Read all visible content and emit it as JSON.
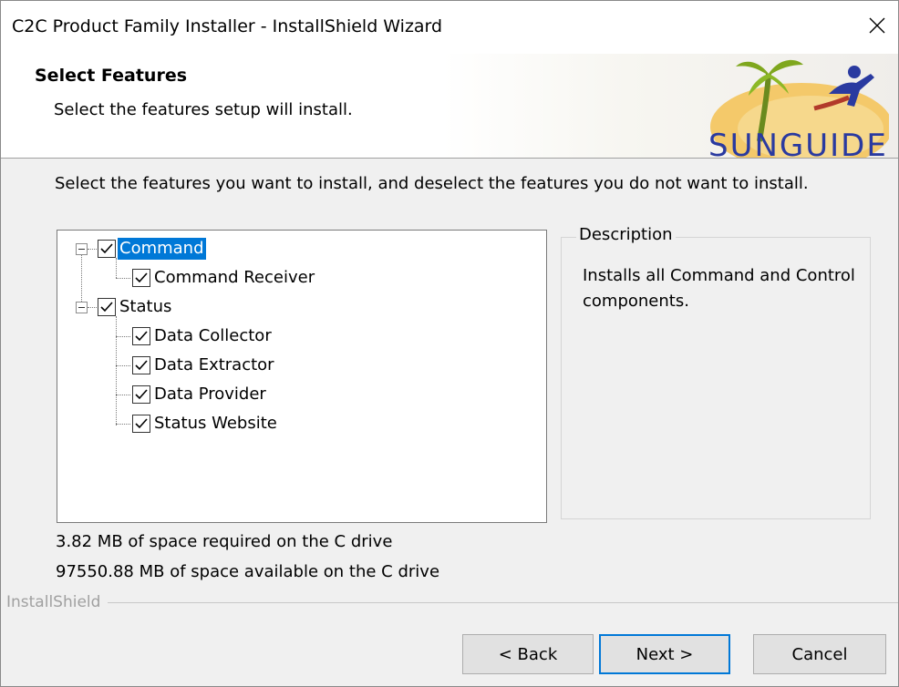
{
  "window": {
    "title": "C2C Product Family Installer - InstallShield Wizard",
    "close_icon": "close-icon"
  },
  "header": {
    "title": "Select Features",
    "subtitle": "Select the features setup will install.",
    "logo_text": "SUNGUIDE",
    "logo_icon": "sunguide-logo"
  },
  "instruction": "Select the features you want to install, and deselect the features you do not want to install.",
  "tree": {
    "items": [
      {
        "label": "Command",
        "checked": true,
        "level": 0,
        "selected": true
      },
      {
        "label": "Command Receiver",
        "checked": true,
        "level": 1
      },
      {
        "label": "Status",
        "checked": true,
        "level": 0
      },
      {
        "label": "Data Collector",
        "checked": true,
        "level": 1
      },
      {
        "label": "Data Extractor",
        "checked": true,
        "level": 1
      },
      {
        "label": "Data Provider",
        "checked": true,
        "level": 1
      },
      {
        "label": "Status Website",
        "checked": true,
        "level": 1
      }
    ]
  },
  "description": {
    "legend": "Description",
    "text": "Installs all Command and Control components."
  },
  "space": {
    "required": "3.82 MB of space required on the C drive",
    "available": "97550.88 MB of space available on the C drive"
  },
  "branding": "InstallShield",
  "buttons": {
    "back": "< Back",
    "next": "Next >",
    "cancel": "Cancel"
  },
  "colors": {
    "selection": "#0078d7",
    "default_button_border": "#0078d7"
  }
}
